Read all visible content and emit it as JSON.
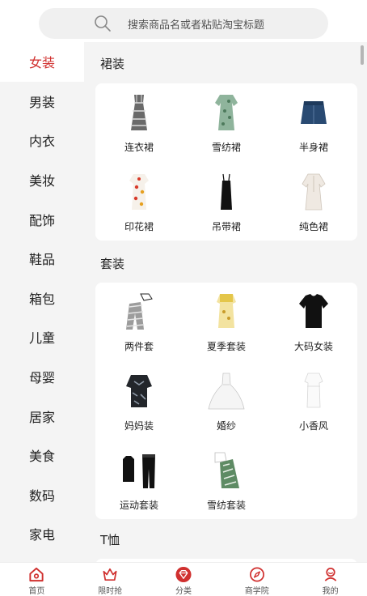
{
  "search": {
    "placeholder": "搜索商品名或者粘贴淘宝标题",
    "icon": "search-icon"
  },
  "sidebar": {
    "items": [
      {
        "label": "女装",
        "active": true
      },
      {
        "label": "男装",
        "active": false
      },
      {
        "label": "内衣",
        "active": false
      },
      {
        "label": "美妆",
        "active": false
      },
      {
        "label": "配饰",
        "active": false
      },
      {
        "label": "鞋品",
        "active": false
      },
      {
        "label": "箱包",
        "active": false
      },
      {
        "label": "儿童",
        "active": false
      },
      {
        "label": "母婴",
        "active": false
      },
      {
        "label": "居家",
        "active": false
      },
      {
        "label": "美食",
        "active": false
      },
      {
        "label": "数码",
        "active": false
      },
      {
        "label": "家电",
        "active": false
      }
    ]
  },
  "sections": [
    {
      "title": "裙装",
      "items": [
        {
          "label": "连衣裙",
          "icon": "checked-dress-icon"
        },
        {
          "label": "雪纺裙",
          "icon": "chiffon-dress-icon"
        },
        {
          "label": "半身裙",
          "icon": "denim-skirt-icon"
        },
        {
          "label": "印花裙",
          "icon": "print-dress-icon"
        },
        {
          "label": "吊带裙",
          "icon": "slip-dress-icon"
        },
        {
          "label": "纯色裙",
          "icon": "solid-dress-icon"
        }
      ]
    },
    {
      "title": "套装",
      "items": [
        {
          "label": "两件套",
          "icon": "two-piece-icon"
        },
        {
          "label": "夏季套装",
          "icon": "summer-set-icon"
        },
        {
          "label": "大码女装",
          "icon": "plus-size-tee-icon"
        },
        {
          "label": "妈妈装",
          "icon": "mom-outfit-icon"
        },
        {
          "label": "婚纱",
          "icon": "wedding-dress-icon"
        },
        {
          "label": "小香风",
          "icon": "tweed-dress-icon"
        },
        {
          "label": "运动套装",
          "icon": "sport-set-icon"
        },
        {
          "label": "雪纺套装",
          "icon": "chiffon-set-icon"
        }
      ]
    },
    {
      "title": "T恤",
      "items": []
    }
  ],
  "bottom_nav": [
    {
      "label": "首页",
      "icon": "home-icon",
      "color": "#d0302f"
    },
    {
      "label": "限时抢",
      "icon": "crown-icon",
      "color": "#d0302f"
    },
    {
      "label": "分类",
      "icon": "category-gem-icon",
      "color": "#d0302f"
    },
    {
      "label": "商学院",
      "icon": "compass-icon",
      "color": "#d0302f"
    },
    {
      "label": "我的",
      "icon": "profile-icon",
      "color": "#d0302f"
    }
  ],
  "colors": {
    "accent": "#d0302f",
    "background": "#f4f4f4",
    "card": "#ffffff"
  }
}
